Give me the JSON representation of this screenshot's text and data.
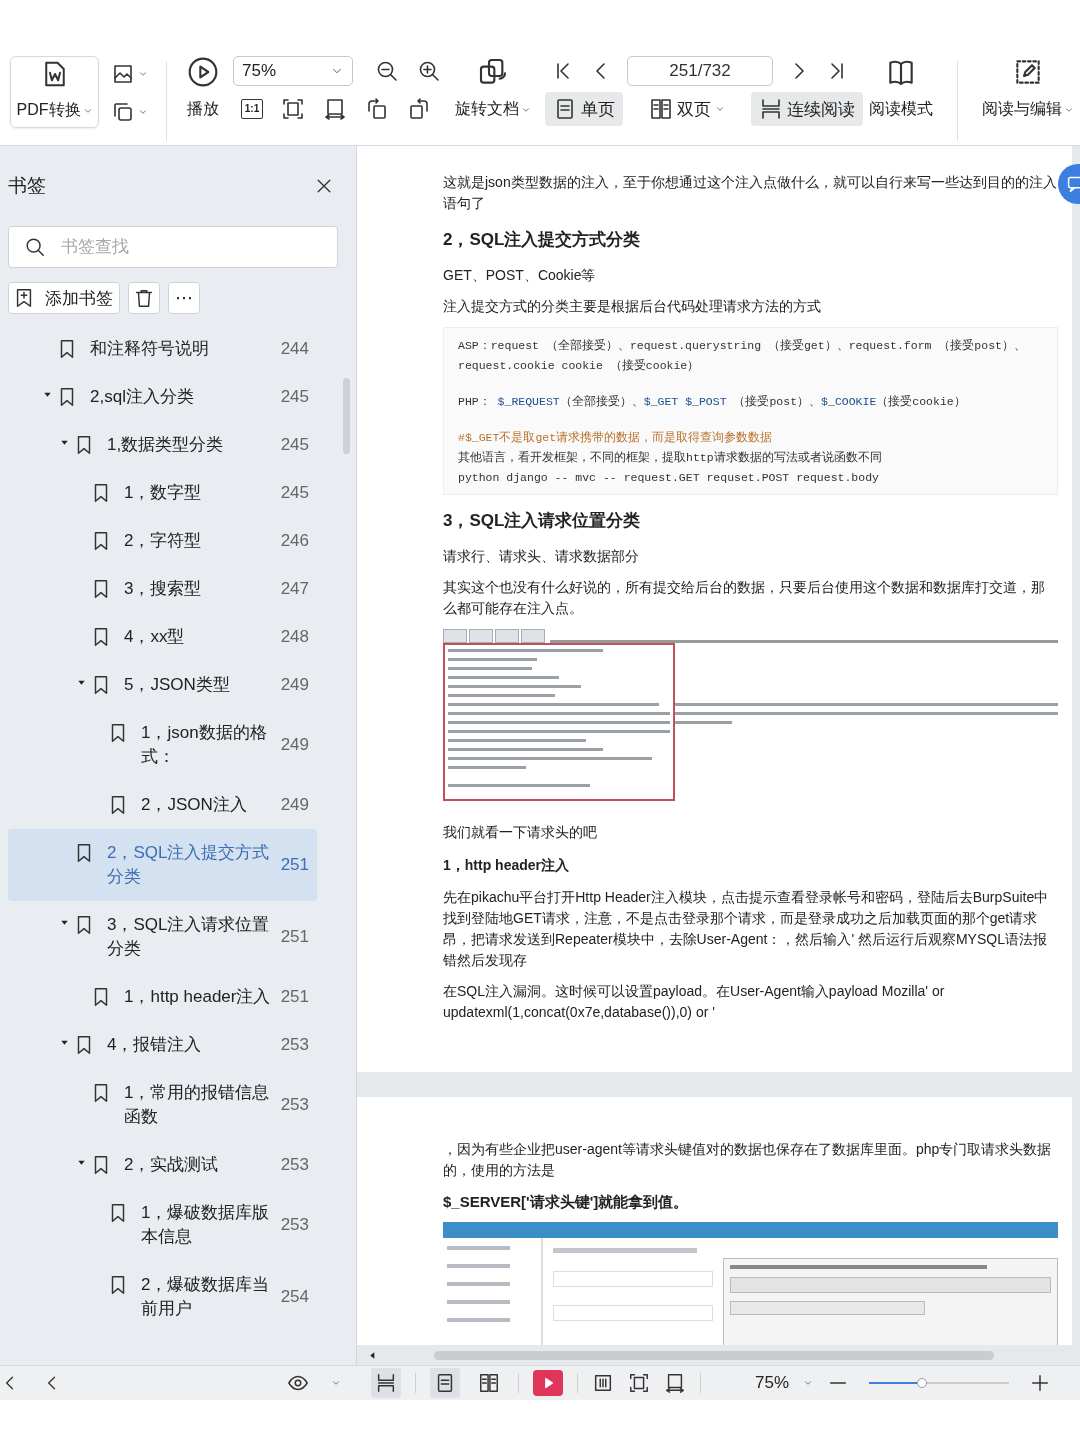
{
  "toolbar": {
    "pdf_convert": {
      "label": "PDF转换"
    },
    "play": {
      "label": "播放"
    },
    "zoom": {
      "value": "75%"
    },
    "actual_size": {
      "label": "1:1"
    },
    "rotate": {
      "label": "旋转文档"
    },
    "page_field": {
      "value": "251/732"
    },
    "view_modes": [
      {
        "kind": "single",
        "label": "单页",
        "selected": true,
        "dropdown": false
      },
      {
        "kind": "double",
        "label": "双页",
        "selected": false,
        "dropdown": true
      },
      {
        "kind": "continuous",
        "label": "连续阅读",
        "selected": true,
        "dropdown": false
      }
    ],
    "reading_mode": {
      "label": "阅读模式"
    },
    "edit": {
      "label": "阅读与编辑"
    }
  },
  "sidebar": {
    "title": "书签",
    "search": {
      "placeholder": "书签查找"
    },
    "add_button": "添加书签",
    "more_button": "⋯",
    "bookmarks": [
      {
        "title": "和注释符号说明",
        "page": "244",
        "selected": false
      },
      {
        "title": "2,sql注入分类",
        "page": "245",
        "selected": false,
        "expanded": true,
        "children": [
          {
            "title": "1,数据类型分类",
            "page": "245",
            "selected": false,
            "expanded": true,
            "children": [
              {
                "title": "1，数字型",
                "page": "245",
                "selected": false
              },
              {
                "title": "2，字符型",
                "page": "246",
                "selected": false
              },
              {
                "title": "3，搜索型",
                "page": "247",
                "selected": false
              },
              {
                "title": "4，xx型",
                "page": "248",
                "selected": false
              },
              {
                "title": "5，JSON类型",
                "page": "249",
                "selected": false,
                "expanded": true,
                "children": [
                  {
                    "title": "1，json数据的格式：",
                    "page": "249",
                    "selected": false
                  },
                  {
                    "title": "2，JSON注入",
                    "page": "249",
                    "selected": false
                  }
                ]
              }
            ]
          },
          {
            "title": "2，SQL注入提交方式分类",
            "page": "251",
            "selected": true
          },
          {
            "title": "3，SQL注入请求位置分类",
            "page": "251",
            "selected": false,
            "expanded": true,
            "children": [
              {
                "title": "1，http header注入",
                "page": "251",
                "selected": false
              }
            ]
          },
          {
            "title": "4，报错注入",
            "page": "253",
            "selected": false,
            "expanded": true,
            "children": [
              {
                "title": "1，常用的报错信息函数",
                "page": "253",
                "selected": false
              },
              {
                "title": "2，实战测试",
                "page": "253",
                "selected": false,
                "expanded": true,
                "children": [
                  {
                    "title": "1，爆破数据库版本信息",
                    "page": "253",
                    "selected": false
                  },
                  {
                    "title": "2，爆破数据库当前用户",
                    "page": "254",
                    "selected": false
                  }
                ]
              }
            ]
          }
        ]
      }
    ]
  },
  "document": {
    "pages": [
      {
        "blocks": [
          {
            "kind": "paragraph",
            "text": "这就是json类型数据的注入，至于你想通过这个注入点做什么，就可以自行来写一些达到目的的注入语句了"
          },
          {
            "kind": "heading",
            "text": "2，SQL注入提交方式分类"
          },
          {
            "kind": "paragraph",
            "text": "GET、POST、Cookie等"
          },
          {
            "kind": "paragraph",
            "text": "注入提交方式的分类主要是根据后台代码处理请求方法的方式"
          },
          {
            "kind": "code",
            "paragraphs": [
              [
                [
                  {
                    "kind": "plain",
                    "text": "ASP：request （全部接受）、request.querystring （接受get）、request.form （接受post）、request.cookie cookie （接受cookie）"
                  }
                ]
              ],
              [
                [
                  {
                    "kind": "plain",
                    "text": "PHP： "
                  },
                  {
                    "kind": "var",
                    "text": "$_REQUEST"
                  },
                  {
                    "kind": "plain",
                    "text": "（全部接受）、"
                  },
                  {
                    "kind": "var",
                    "text": "$_GET $_POST"
                  },
                  {
                    "kind": "plain",
                    "text": " （接受post）、"
                  },
                  {
                    "kind": "var",
                    "text": "$_COOKIE"
                  },
                  {
                    "kind": "plain",
                    "text": "（接受cookie）"
                  }
                ]
              ],
              [
                [
                  {
                    "kind": "comment",
                    "text": "#$_GET不是取get请求携带的数据，而是取得查询参数数据"
                  }
                ],
                [
                  {
                    "kind": "plain",
                    "text": "其他语言，看开发框架，不同的框架，提取http请求数据的写法或者说函数不同"
                  }
                ],
                [
                  {
                    "kind": "plain",
                    "text": "python django -- mvc -- request.GET  requset.POST   request.body"
                  }
                ]
              ]
            ]
          },
          {
            "kind": "heading",
            "text": "3，SQL注入请求位置分类"
          },
          {
            "kind": "paragraph",
            "text": "请求行、请求头、请求数据部分"
          },
          {
            "kind": "paragraph",
            "text": "其实这个也没有什么好说的，所有提交给后台的数据，只要后台使用这个数据和数据库打交道，那么都可能存在注入点。"
          },
          {
            "kind": "request-figure"
          },
          {
            "kind": "paragraph",
            "text": "我们就看一下请求头的吧"
          },
          {
            "kind": "subheading",
            "text": "1，http header注入"
          },
          {
            "kind": "paragraph",
            "text": "先在pikachu平台打开Http Header注入模块，点击提示查看登录帐号和密码，登陆后去BurpSuite中找到登陆地GET请求，注意，不是点击登录那个请求，而是登录成功之后加载页面的那个get请求昂，把请求发送到Repeater模块中，去除User-Agent：，然后输入' 然后运行后观察MYSQL语法报错然后发现存"
          },
          {
            "kind": "paragraph",
            "text": "在SQL注入漏洞。这时候可以设置payload。在User-Agent输入payload Mozilla' or updatexml(1,concat(0x7e,database()),0) or '"
          }
        ]
      },
      {
        "blocks": [
          {
            "kind": "paragraph",
            "text": "，因为有些企业把user-agent等请求头键值对的数据也保存在了数据库里面。php专门取请求头数据的，使用的方法是"
          },
          {
            "kind": "strong",
            "text": "$_SERVER['请求头键']就能拿到值。"
          },
          {
            "kind": "webpage-figure"
          }
        ]
      }
    ]
  },
  "bottom_bar": {
    "view_buttons": [
      {
        "kind": "continuous",
        "selected": true
      },
      {
        "kind": "single",
        "selected": true
      },
      {
        "kind": "double",
        "selected": false
      }
    ],
    "zoom": {
      "value": "75%"
    },
    "zoom_slider": {
      "level": 0.38
    }
  }
}
